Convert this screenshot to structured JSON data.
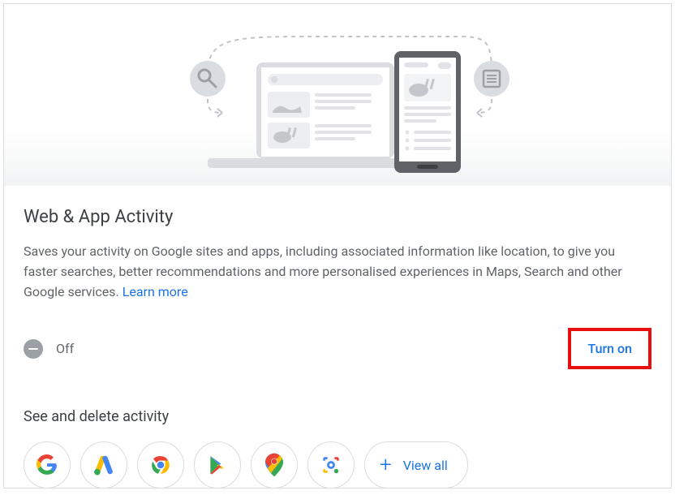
{
  "hero": {
    "alt": "Illustration of web and app activity across devices"
  },
  "main": {
    "title": "Web & App Activity",
    "description_prefix": "Saves your activity on Google sites and apps, including associated information like location, to give you faster searches, better recommendations and more personalised experiences in Maps, Search and other Google services. ",
    "learn_more": "Learn more"
  },
  "status": {
    "state": "off",
    "label": "Off",
    "turn_on_label": "Turn on"
  },
  "activity": {
    "heading": "See and delete activity",
    "apps": [
      {
        "name": "google-search-icon",
        "aria": "Google Search"
      },
      {
        "name": "google-ads-icon",
        "aria": "Google Ads"
      },
      {
        "name": "chrome-icon",
        "aria": "Chrome"
      },
      {
        "name": "play-store-icon",
        "aria": "Google Play"
      },
      {
        "name": "google-maps-icon",
        "aria": "Google Maps"
      },
      {
        "name": "google-lens-icon",
        "aria": "Google Lens"
      }
    ],
    "view_all_label": "View all"
  },
  "colors": {
    "link": "#1a73e8",
    "text_muted": "#5f6368",
    "highlight_border": "#e8100f"
  }
}
